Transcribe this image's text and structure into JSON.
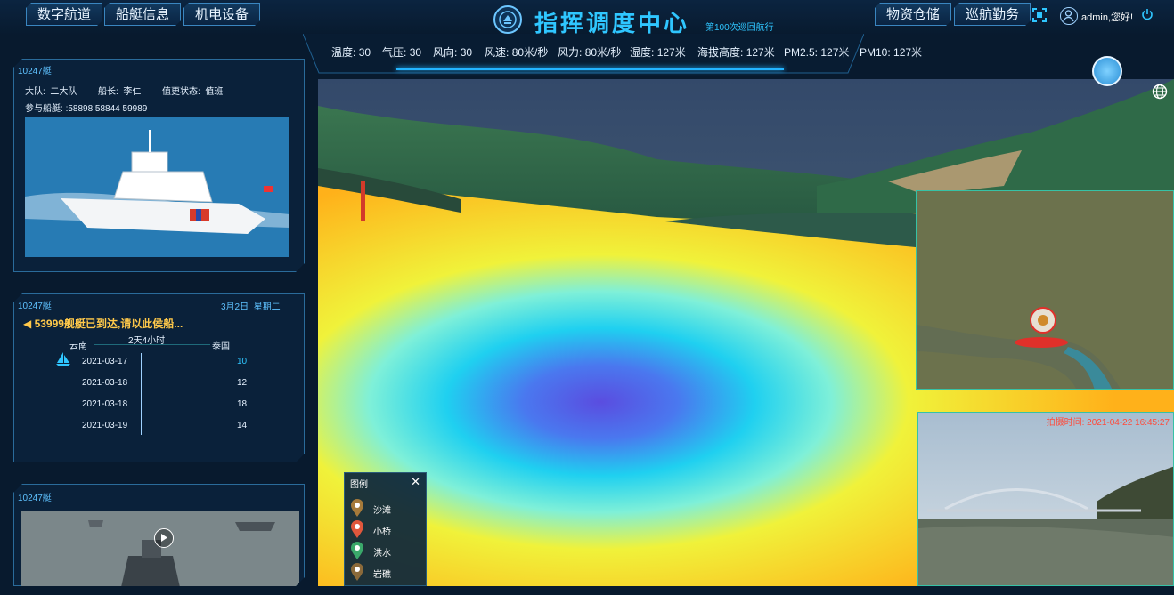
{
  "nav": {
    "left": [
      "数字航道",
      "船艇信息",
      "机电设备"
    ],
    "right": [
      "物资仓储",
      "巡航勤务"
    ]
  },
  "header": {
    "title": "指挥调度中心",
    "subtitle": "第100次巡回航行",
    "user": "admin,您好!"
  },
  "weather": [
    {
      "label": "温度:",
      "value": "30"
    },
    {
      "label": "气压:",
      "value": "30"
    },
    {
      "label": "风向:",
      "value": "30"
    },
    {
      "label": "风速:",
      "value": "80米/秒"
    },
    {
      "label": "风力:",
      "value": "80米/秒"
    },
    {
      "label": "湿度:",
      "value": "127米"
    },
    {
      "label": "海拔高度:",
      "value": "127米"
    },
    {
      "label": "PM2.5:",
      "value": "127米"
    },
    {
      "label": "PM10:",
      "value": "127米"
    }
  ],
  "boat_panel": {
    "tab": "10247艇",
    "team_label": "大队:",
    "team_value": "二大队",
    "captain_label": "船长:",
    "captain_value": "李仁",
    "status_label": "值更状态:",
    "status_value": "值班",
    "boats_label": "参与船艇:",
    "boats_value": ":58898 58844 59989"
  },
  "route_panel": {
    "tab": "10247艇",
    "date": "3月2日",
    "weekday": "星期二",
    "notice": "53999舰艇已到达,请以此侯船...",
    "from": "云南",
    "duration": "2天4小时",
    "to": "泰国",
    "rows": [
      {
        "date": "2021-03-17",
        "value": "10"
      },
      {
        "date": "2021-03-18",
        "value": "12"
      },
      {
        "date": "2021-03-18",
        "value": "18"
      },
      {
        "date": "2021-03-19",
        "value": "14"
      }
    ]
  },
  "video_panel": {
    "tab": "10247艇"
  },
  "legend": {
    "title": "图例",
    "items": [
      {
        "label": "沙滩",
        "color": "#a57a3a"
      },
      {
        "label": "小桥",
        "color": "#e0573c"
      },
      {
        "label": "洪水",
        "color": "#3aa86a"
      },
      {
        "label": "岩礁",
        "color": "#8b6a3a"
      }
    ]
  },
  "camera": {
    "time": "拍摄时间: 2021-04-22 16:45:27"
  },
  "colors": {
    "accent": "#2fc6ff",
    "notice": "#ffc94a",
    "border": "#2a6b9a"
  }
}
